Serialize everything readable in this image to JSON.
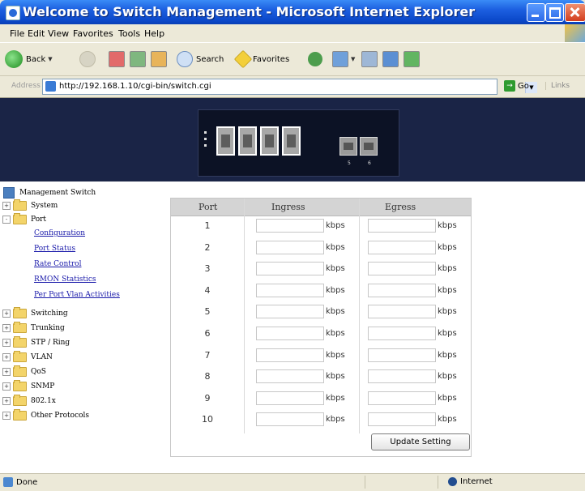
{
  "window": {
    "title": "Welcome to Switch Management - Microsoft Internet Explorer"
  },
  "menu": [
    "File",
    "Edit",
    "View",
    "Favorites",
    "Tools",
    "Help"
  ],
  "toolbar": {
    "back_label": "Back",
    "search_label": "Search",
    "favorites_label": "Favorites"
  },
  "address": {
    "label": "Address",
    "url": "http://192.168.1.10/cgi-bin/switch.cgi",
    "go_label": "Go",
    "links_label": "Links"
  },
  "banner": {
    "sfp_labels": [
      "5",
      "6"
    ]
  },
  "tree": {
    "root": "Management Switch",
    "nodes": [
      {
        "label": "System",
        "expander": "+"
      },
      {
        "label": "Port",
        "expander": "-"
      },
      {
        "label": "Switching",
        "expander": "+"
      },
      {
        "label": "Trunking",
        "expander": "+"
      },
      {
        "label": "STP / Ring",
        "expander": "+"
      },
      {
        "label": "VLAN",
        "expander": "+"
      },
      {
        "label": "QoS",
        "expander": "+"
      },
      {
        "label": "SNMP",
        "expander": "+"
      },
      {
        "label": "802.1x",
        "expander": "+"
      },
      {
        "label": "Other Protocols",
        "expander": "+"
      }
    ],
    "port_children": [
      "Configuration",
      "Port Status",
      "Rate Control",
      "RMON Statistics",
      "Per Port Vlan Activities"
    ]
  },
  "port_table": {
    "headers": {
      "port": "Port",
      "ingress": "Ingress",
      "egress": "Egress"
    },
    "unit": "kbps",
    "rows": [
      "1",
      "2",
      "3",
      "4",
      "5",
      "6",
      "7",
      "8",
      "9",
      "10"
    ],
    "update_button": "Update Setting"
  },
  "status": {
    "left": "Done",
    "zone": "Internet"
  },
  "colors": {
    "titlebar": "#0B48C9",
    "banner": "#1a2446",
    "link": "#1a1aaa"
  }
}
